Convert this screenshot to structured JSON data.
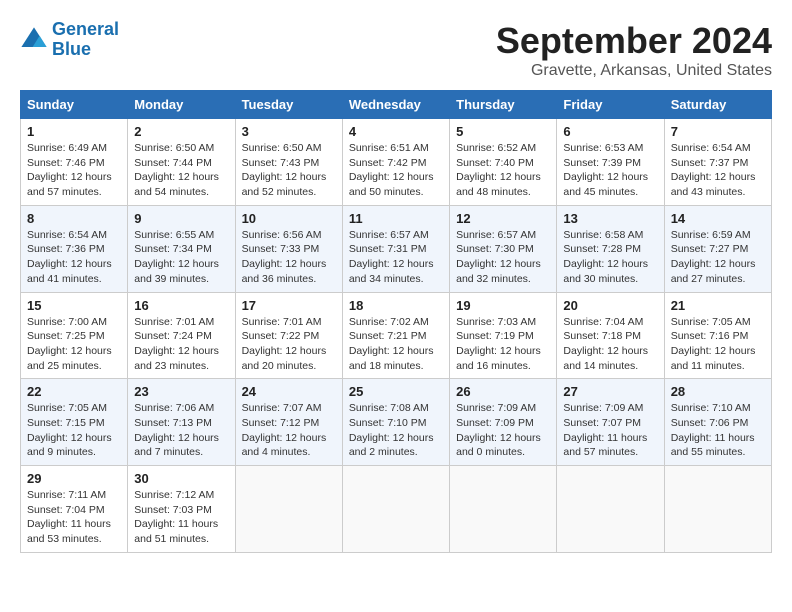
{
  "header": {
    "logo_line1": "General",
    "logo_line2": "Blue",
    "month_title": "September 2024",
    "location": "Gravette, Arkansas, United States"
  },
  "calendar": {
    "headers": [
      "Sunday",
      "Monday",
      "Tuesday",
      "Wednesday",
      "Thursday",
      "Friday",
      "Saturday"
    ],
    "weeks": [
      [
        {
          "day": "",
          "info": ""
        },
        {
          "day": "2",
          "info": "Sunrise: 6:50 AM\nSunset: 7:44 PM\nDaylight: 12 hours and 54 minutes."
        },
        {
          "day": "3",
          "info": "Sunrise: 6:50 AM\nSunset: 7:43 PM\nDaylight: 12 hours and 52 minutes."
        },
        {
          "day": "4",
          "info": "Sunrise: 6:51 AM\nSunset: 7:42 PM\nDaylight: 12 hours and 50 minutes."
        },
        {
          "day": "5",
          "info": "Sunrise: 6:52 AM\nSunset: 7:40 PM\nDaylight: 12 hours and 48 minutes."
        },
        {
          "day": "6",
          "info": "Sunrise: 6:53 AM\nSunset: 7:39 PM\nDaylight: 12 hours and 45 minutes."
        },
        {
          "day": "7",
          "info": "Sunrise: 6:54 AM\nSunset: 7:37 PM\nDaylight: 12 hours and 43 minutes."
        }
      ],
      [
        {
          "day": "8",
          "info": "Sunrise: 6:54 AM\nSunset: 7:36 PM\nDaylight: 12 hours and 41 minutes."
        },
        {
          "day": "9",
          "info": "Sunrise: 6:55 AM\nSunset: 7:34 PM\nDaylight: 12 hours and 39 minutes."
        },
        {
          "day": "10",
          "info": "Sunrise: 6:56 AM\nSunset: 7:33 PM\nDaylight: 12 hours and 36 minutes."
        },
        {
          "day": "11",
          "info": "Sunrise: 6:57 AM\nSunset: 7:31 PM\nDaylight: 12 hours and 34 minutes."
        },
        {
          "day": "12",
          "info": "Sunrise: 6:57 AM\nSunset: 7:30 PM\nDaylight: 12 hours and 32 minutes."
        },
        {
          "day": "13",
          "info": "Sunrise: 6:58 AM\nSunset: 7:28 PM\nDaylight: 12 hours and 30 minutes."
        },
        {
          "day": "14",
          "info": "Sunrise: 6:59 AM\nSunset: 7:27 PM\nDaylight: 12 hours and 27 minutes."
        }
      ],
      [
        {
          "day": "15",
          "info": "Sunrise: 7:00 AM\nSunset: 7:25 PM\nDaylight: 12 hours and 25 minutes."
        },
        {
          "day": "16",
          "info": "Sunrise: 7:01 AM\nSunset: 7:24 PM\nDaylight: 12 hours and 23 minutes."
        },
        {
          "day": "17",
          "info": "Sunrise: 7:01 AM\nSunset: 7:22 PM\nDaylight: 12 hours and 20 minutes."
        },
        {
          "day": "18",
          "info": "Sunrise: 7:02 AM\nSunset: 7:21 PM\nDaylight: 12 hours and 18 minutes."
        },
        {
          "day": "19",
          "info": "Sunrise: 7:03 AM\nSunset: 7:19 PM\nDaylight: 12 hours and 16 minutes."
        },
        {
          "day": "20",
          "info": "Sunrise: 7:04 AM\nSunset: 7:18 PM\nDaylight: 12 hours and 14 minutes."
        },
        {
          "day": "21",
          "info": "Sunrise: 7:05 AM\nSunset: 7:16 PM\nDaylight: 12 hours and 11 minutes."
        }
      ],
      [
        {
          "day": "22",
          "info": "Sunrise: 7:05 AM\nSunset: 7:15 PM\nDaylight: 12 hours and 9 minutes."
        },
        {
          "day": "23",
          "info": "Sunrise: 7:06 AM\nSunset: 7:13 PM\nDaylight: 12 hours and 7 minutes."
        },
        {
          "day": "24",
          "info": "Sunrise: 7:07 AM\nSunset: 7:12 PM\nDaylight: 12 hours and 4 minutes."
        },
        {
          "day": "25",
          "info": "Sunrise: 7:08 AM\nSunset: 7:10 PM\nDaylight: 12 hours and 2 minutes."
        },
        {
          "day": "26",
          "info": "Sunrise: 7:09 AM\nSunset: 7:09 PM\nDaylight: 12 hours and 0 minutes."
        },
        {
          "day": "27",
          "info": "Sunrise: 7:09 AM\nSunset: 7:07 PM\nDaylight: 11 hours and 57 minutes."
        },
        {
          "day": "28",
          "info": "Sunrise: 7:10 AM\nSunset: 7:06 PM\nDaylight: 11 hours and 55 minutes."
        }
      ],
      [
        {
          "day": "29",
          "info": "Sunrise: 7:11 AM\nSunset: 7:04 PM\nDaylight: 11 hours and 53 minutes."
        },
        {
          "day": "30",
          "info": "Sunrise: 7:12 AM\nSunset: 7:03 PM\nDaylight: 11 hours and 51 minutes."
        },
        {
          "day": "",
          "info": ""
        },
        {
          "day": "",
          "info": ""
        },
        {
          "day": "",
          "info": ""
        },
        {
          "day": "",
          "info": ""
        },
        {
          "day": "",
          "info": ""
        }
      ]
    ],
    "week0": {
      "day1": {
        "day": "1",
        "info": "Sunrise: 6:49 AM\nSunset: 7:46 PM\nDaylight: 12 hours and 57 minutes."
      }
    }
  }
}
